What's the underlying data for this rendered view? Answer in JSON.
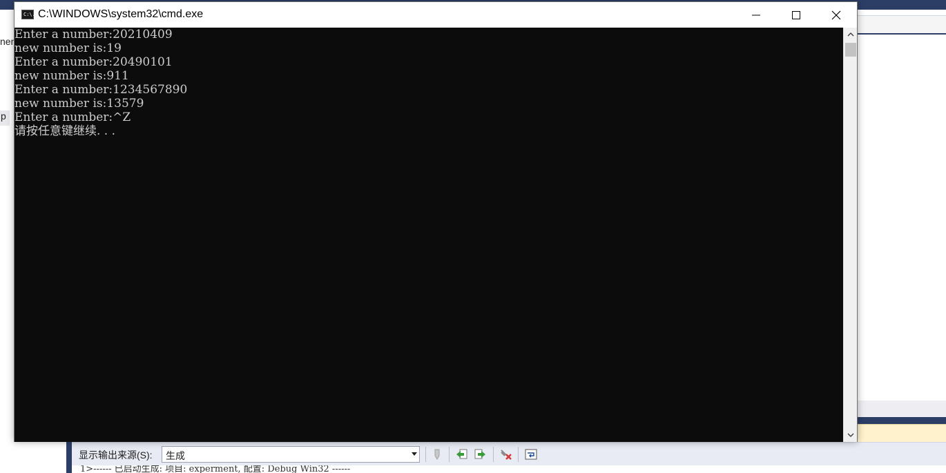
{
  "cmd_window": {
    "title": "C:\\WINDOWS\\system32\\cmd.exe",
    "icon_text": "C:\\.",
    "console_lines": [
      "Enter a number:20210409",
      "new number is:19",
      "Enter a number:20490101",
      "new number is:911",
      "Enter a number:1234567890",
      "new number is:13579",
      "Enter a number:^Z",
      "请按任意键继续. . ."
    ],
    "colors": {
      "console_bg": "#0c0c0c",
      "console_text": "#cccccc"
    }
  },
  "ide": {
    "left_fragments": [
      "nen",
      "p"
    ],
    "output_panel": {
      "source_label": "显示输出来源(S):",
      "source_value": "生成",
      "output_line": "1>------ 已启动生成: 项目: experment, 配置: Debug Win32 ------"
    },
    "colors": {
      "frame": "#2d3e66",
      "toolbar": "#e8ebf3"
    }
  }
}
